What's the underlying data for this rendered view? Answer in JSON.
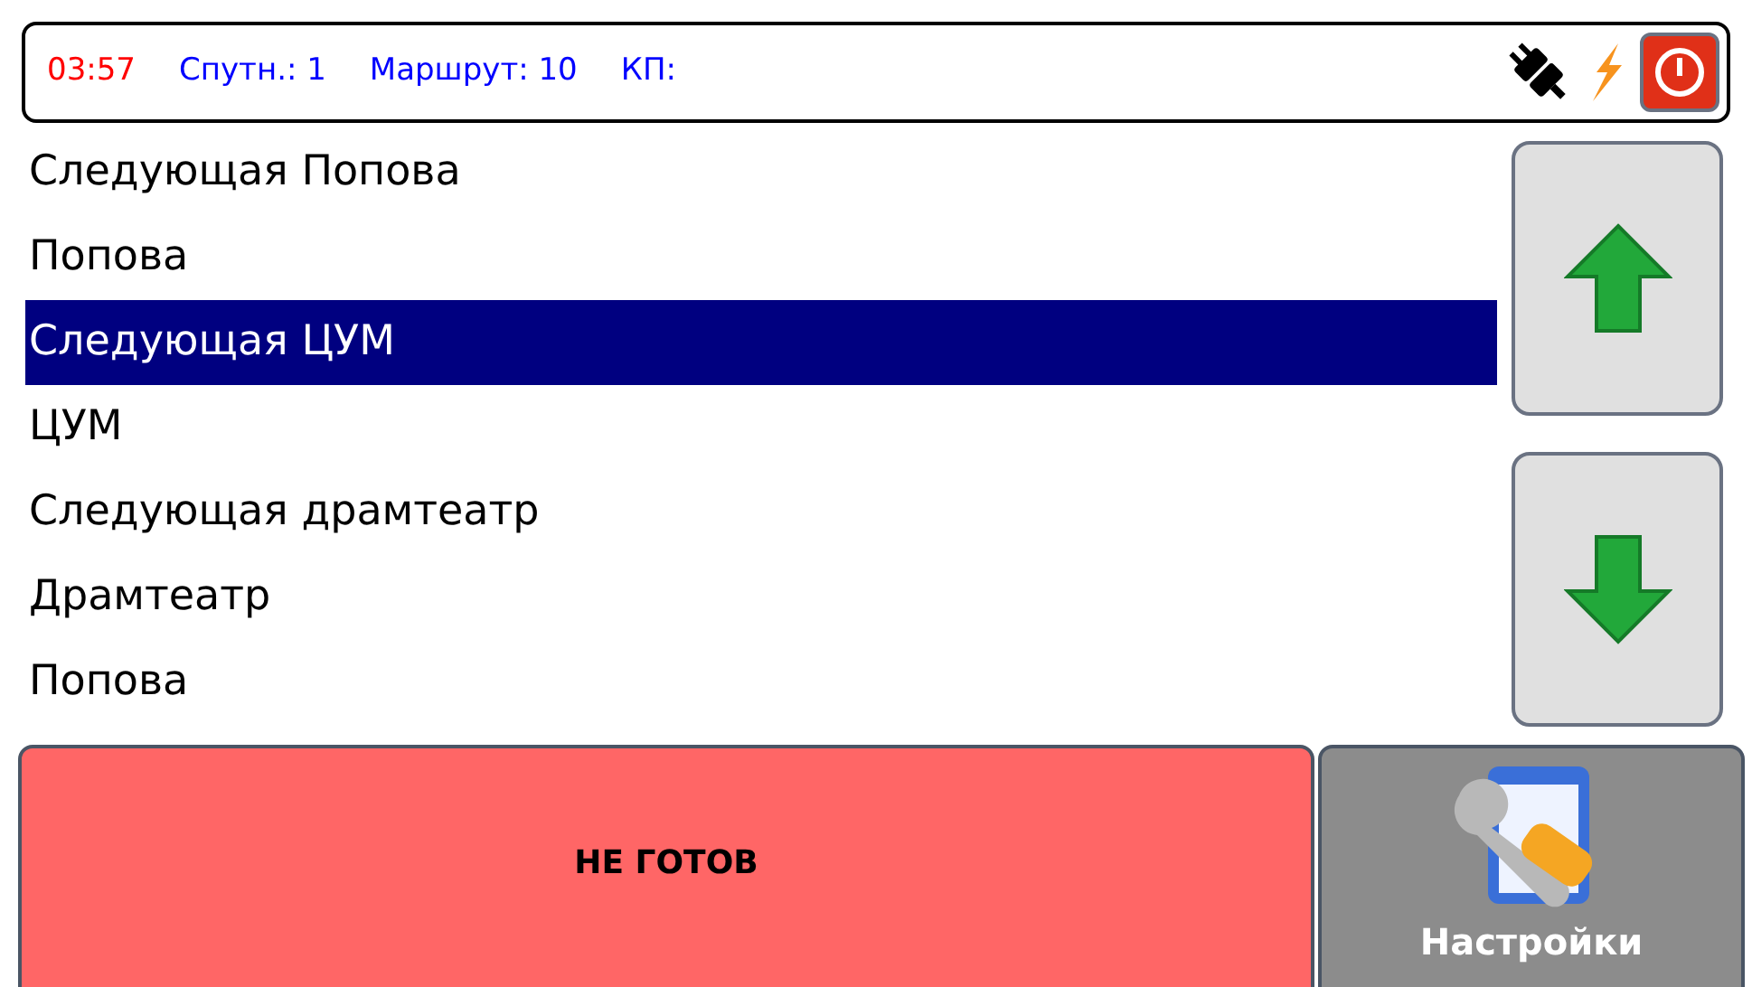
{
  "status_bar": {
    "items": [
      {
        "text": "03:57",
        "color": "#ff0000"
      },
      {
        "text": "Спутн.: 1",
        "color": "#0000ff"
      },
      {
        "text": "Маршрут: 10",
        "color": "#0000ff"
      },
      {
        "text": "КП:",
        "color": "#0000ff"
      }
    ]
  },
  "stops": [
    {
      "label": "Следующая Попова",
      "selected": false
    },
    {
      "label": "Попова",
      "selected": false
    },
    {
      "label": "Следующая ЦУМ",
      "selected": true
    },
    {
      "label": "ЦУМ",
      "selected": false
    },
    {
      "label": "Следующая драмтеатр",
      "selected": false
    },
    {
      "label": "Драмтеатр",
      "selected": false
    },
    {
      "label": "Попова",
      "selected": false
    }
  ],
  "status_button": {
    "label": "НЕ ГОТОВ"
  },
  "settings_button": {
    "label": "Настройки"
  }
}
